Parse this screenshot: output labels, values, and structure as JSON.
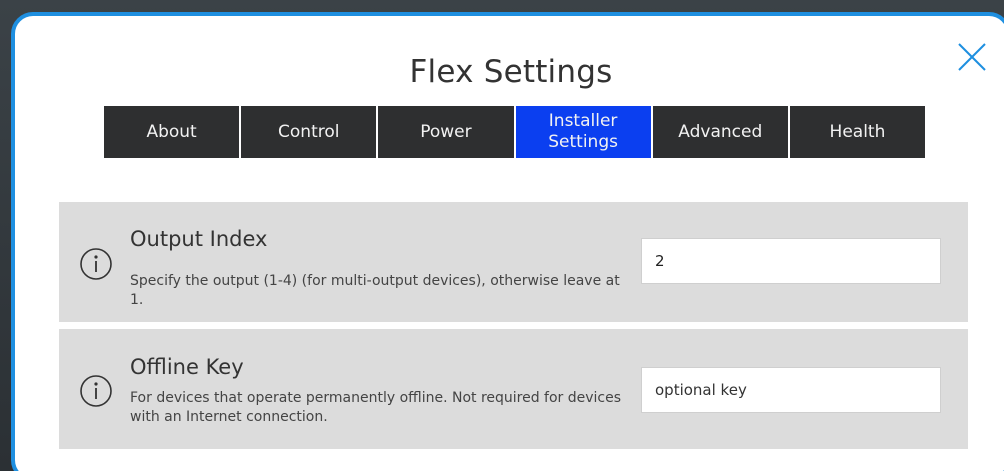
{
  "dialog": {
    "title": "Flex Settings",
    "accent_color": "#1e8fe0",
    "close_icon": "close-icon"
  },
  "tabs": [
    {
      "label": "About",
      "active": false
    },
    {
      "label": "Control",
      "active": false
    },
    {
      "label": "Power",
      "active": false
    },
    {
      "label": "Installer\nSettings",
      "active": true
    },
    {
      "label": "Advanced",
      "active": false
    },
    {
      "label": "Health",
      "active": false
    }
  ],
  "tab_colors": {
    "inactive": "#2e2f30",
    "active": "#0b3ff0"
  },
  "settings": [
    {
      "icon": "info-icon",
      "title": "Output Index",
      "description": "Specify the output (1-4) (for multi-output devices), otherwise leave at 1.",
      "value": "2",
      "placeholder": ""
    },
    {
      "icon": "info-icon",
      "title": "Offline Key",
      "description": "For devices that operate permanently offline. Not required for devices with an Internet connection.",
      "value": "",
      "placeholder": "optional key"
    }
  ]
}
